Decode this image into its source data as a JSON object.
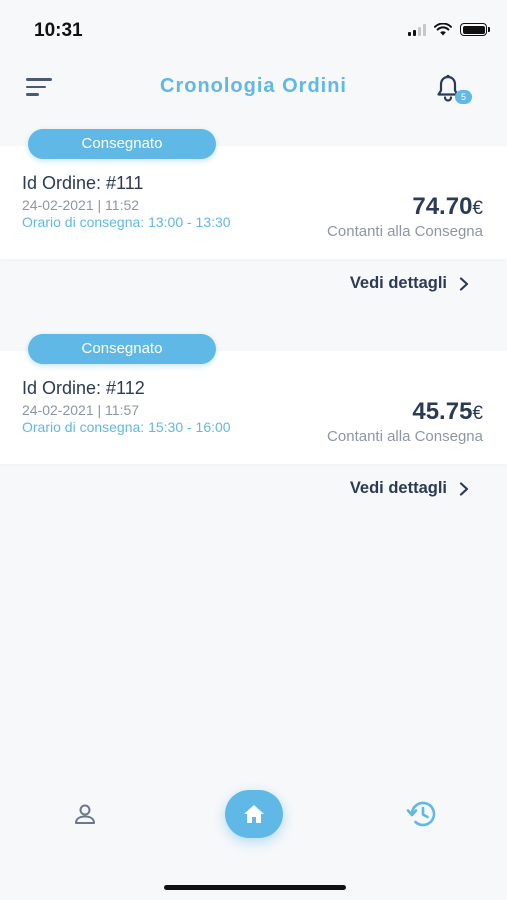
{
  "status_bar": {
    "time": "10:31"
  },
  "header": {
    "title": "Cronologia Ordini",
    "notification_count": "5"
  },
  "orders": [
    {
      "status": "Consegnato",
      "id_label": "Id Ordine: #111",
      "date": "24-02-2021 | 11:52",
      "delivery_time": "Orario di consegna: 13:00 - 13:30",
      "price": "74.70",
      "currency": "€",
      "payment": "Contanti alla Consegna",
      "details_label": "Vedi dettagli"
    },
    {
      "status": "Consegnato",
      "id_label": "Id Ordine: #112",
      "date": "24-02-2021 | 11:57",
      "delivery_time": "Orario di consegna: 15:30 - 16:00",
      "price": "45.75",
      "currency": "€",
      "payment": "Contanti alla Consegna",
      "details_label": "Vedi dettagli"
    }
  ],
  "bottom_nav": {
    "items": [
      {
        "icon": "profile-icon"
      },
      {
        "icon": "home-icon"
      },
      {
        "icon": "history-icon"
      }
    ]
  },
  "colors": {
    "accent": "#5fb8e6",
    "text_dark": "#2b3a55",
    "text_muted": "#8e96a3",
    "background": "#f7f8fa"
  }
}
